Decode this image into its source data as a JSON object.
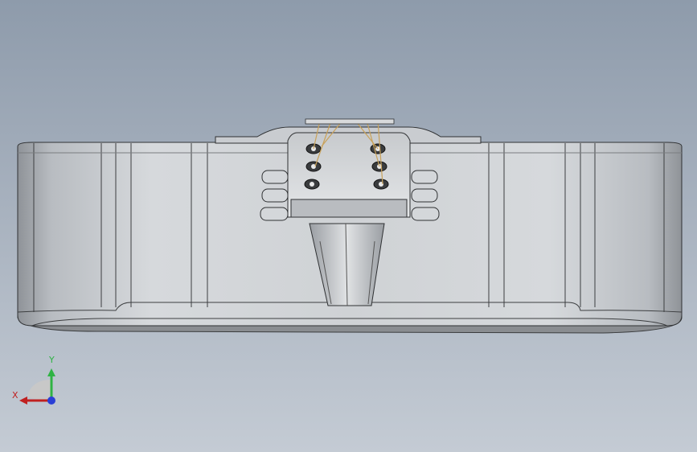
{
  "viewport": {
    "background_top": "#8e9bab",
    "background_bottom": "#c4cbd4",
    "model": "guitar-body-front-view"
  },
  "triad": {
    "y_label": "Y",
    "x_label": "X",
    "y_color": "#2fb344",
    "x_color": "#c02020",
    "z_color": "#2a3fd6"
  }
}
